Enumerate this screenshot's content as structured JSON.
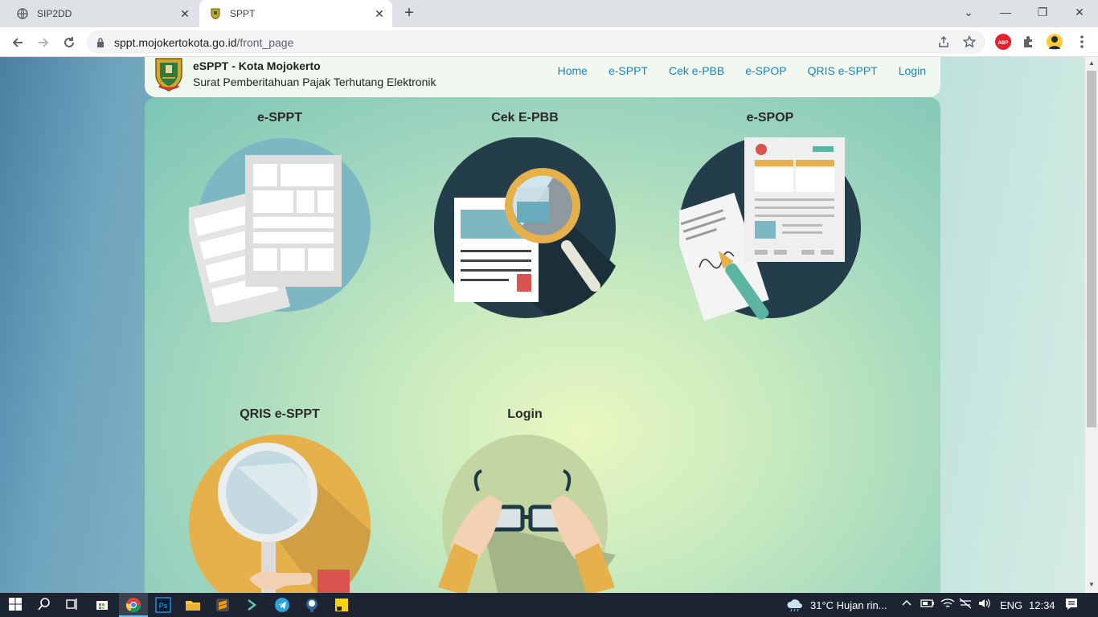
{
  "browser": {
    "tabs": [
      {
        "title": "SIP2DD",
        "active": false
      },
      {
        "title": "SPPT",
        "active": true
      }
    ],
    "new_tab": "+",
    "address": {
      "host": "sppt.mojokertokota.go.id",
      "path": "/front_page"
    }
  },
  "site": {
    "brand": "eSPPT - Kota Mojokerto",
    "subtitle": "Surat Pemberitahuan Pajak Terhutang Elektronik",
    "nav": [
      "Home",
      "e-SPPT",
      "Cek e-PBB",
      "e-SPOP",
      "QRIS e-SPPT",
      "Login"
    ]
  },
  "tiles": [
    {
      "title": "e-SPPT"
    },
    {
      "title": "Cek E-PBB"
    },
    {
      "title": "e-SPOP"
    },
    {
      "title": "QRIS e-SPPT"
    },
    {
      "title": "Login"
    }
  ],
  "taskbar": {
    "weather": "31°C  Hujan rin...",
    "lang": "ENG",
    "time": "12:34"
  },
  "colors": {
    "nav_link": "#1f7fb8",
    "card_bg": "#9fd6bf"
  }
}
